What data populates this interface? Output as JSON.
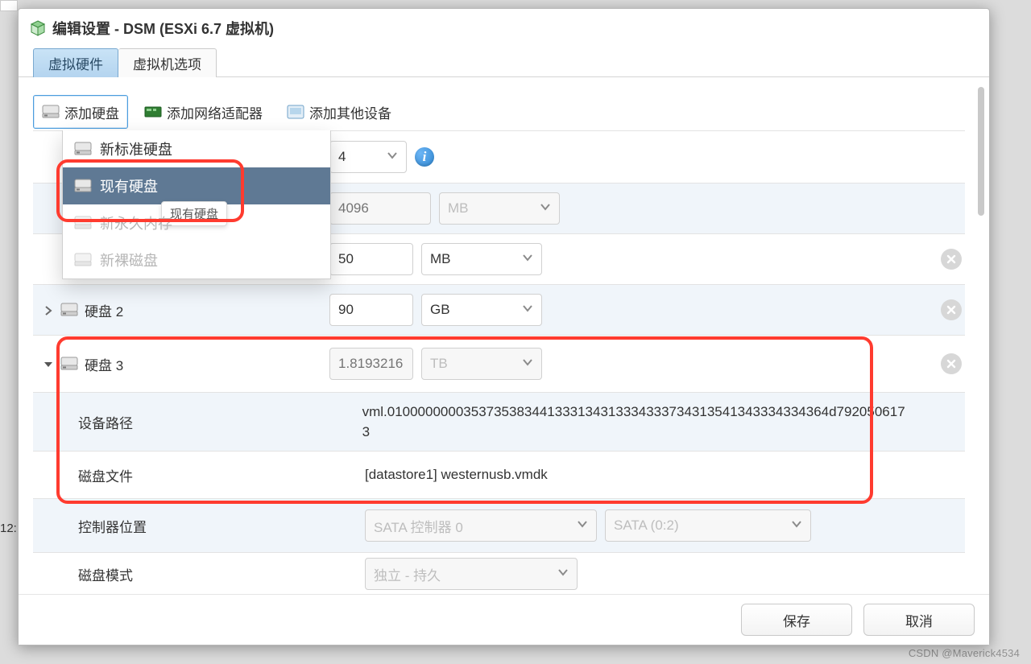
{
  "bg": {
    "time_label": "12:"
  },
  "dialog": {
    "title": "编辑设置 - DSM (ESXi 6.7 虚拟机)",
    "tabs": {
      "hardware": "虚拟硬件",
      "options": "虚拟机选项"
    }
  },
  "toolbar": {
    "add_disk": "添加硬盘",
    "add_nic": "添加网络适配器",
    "add_other": "添加其他设备"
  },
  "dropdown": {
    "new_standard": "新标准硬盘",
    "existing": "现有硬盘",
    "new_persistent": "新永久内存",
    "new_raw": "新裸磁盘",
    "tooltip": "现有硬盘"
  },
  "rows": {
    "cpu": {
      "value": "4"
    },
    "mem": {
      "value_placeholder": "4096",
      "unit": "MB"
    },
    "disk1": {
      "value": "50",
      "unit": "MB"
    },
    "disk2": {
      "label": "硬盘 2",
      "value": "90",
      "unit": "GB"
    },
    "disk3": {
      "label": "硬盘 3",
      "value_placeholder": "1.8193216",
      "unit": "TB",
      "device_path_label": "设备路径",
      "device_path_value": "vml.0100000000353735383441333134313334333734313541343334334364d7920506173",
      "disk_file_label": "磁盘文件",
      "disk_file_value": "[datastore1] westernusb.vmdk",
      "controller_loc_label": "控制器位置",
      "controller_loc_sel1": "SATA 控制器 0",
      "controller_loc_sel2": "SATA (0:2)",
      "disk_mode_label": "磁盘模式",
      "disk_mode_value": "独立 - 持久"
    }
  },
  "footer": {
    "save": "保存",
    "cancel": "取消"
  },
  "watermark": "CSDN @Maverick4534"
}
